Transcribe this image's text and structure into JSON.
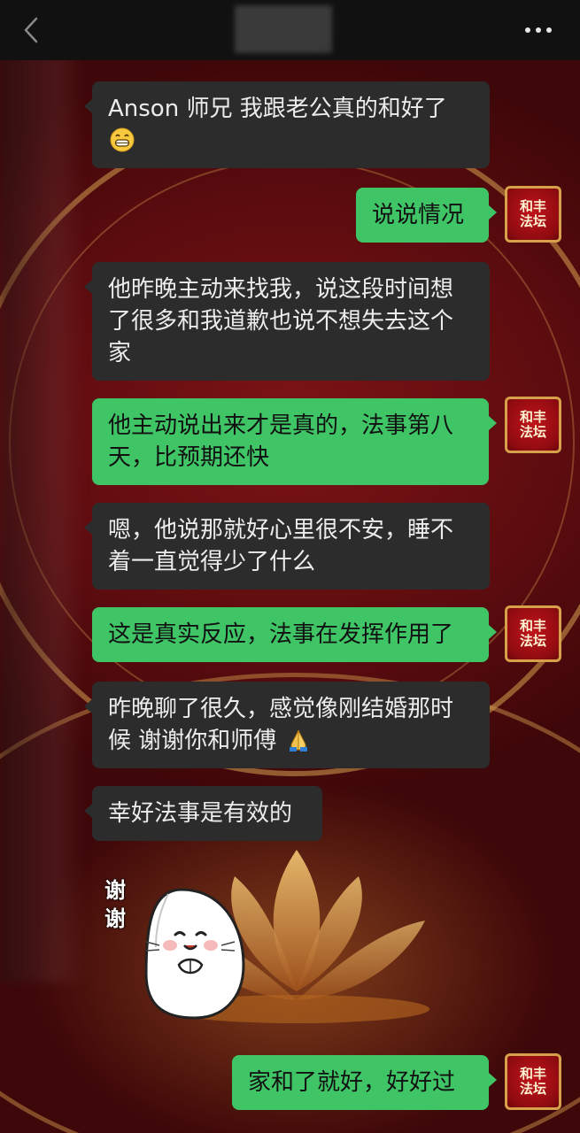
{
  "header": {
    "back_icon": "chevron-left-icon",
    "more_icon": "more-dots-icon"
  },
  "contact": {
    "avatar_text_line1": "和丰",
    "avatar_text_line2": "法坛"
  },
  "messages": [
    {
      "side": "in",
      "text": "Anson 师兄 我跟老公真的和好了",
      "emoji": "grinning-face-icon"
    },
    {
      "side": "out",
      "text": "说说情况"
    },
    {
      "side": "in",
      "text": "他昨晚主动来找我，说这段时间想了很多和我道歉也说不想失去这个家"
    },
    {
      "side": "out",
      "text": "他主动说出来才是真的，法事第八天，比预期还快"
    },
    {
      "side": "in",
      "text": "嗯，他说那就好心里很不安，睡不着一直觉得少了什么"
    },
    {
      "side": "out",
      "text": "这是真实反应，法事在发挥作用了"
    },
    {
      "side": "in",
      "text": "昨晚聊了很久，感觉像刚结婚那时候 谢谢你和师傅",
      "emoji": "folded-hands-icon"
    },
    {
      "side": "in",
      "text": "幸好法事是有效的"
    },
    {
      "side": "in",
      "type": "sticker",
      "sticker_text": "谢谢",
      "sticker_icon": "seal-thank-you-sticker"
    },
    {
      "side": "out",
      "text": "家和了就好，好好过"
    }
  ],
  "colors": {
    "incoming_bubble": "#2c2c2c",
    "outgoing_bubble": "#3fc466",
    "background": "#5a0d10"
  }
}
